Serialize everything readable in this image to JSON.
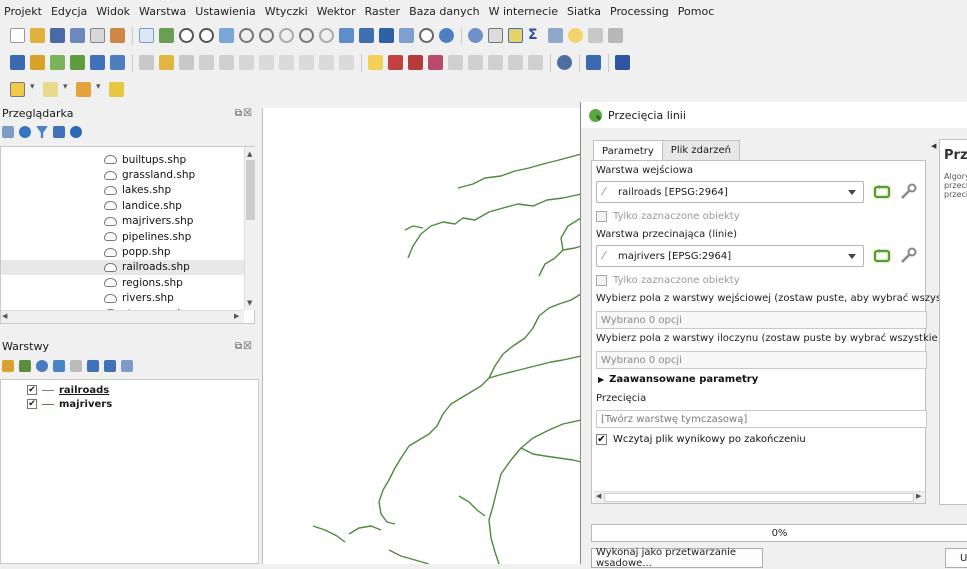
{
  "menubar": [
    "Projekt",
    "Edycja",
    "Widok",
    "Warstwa",
    "Ustawienia",
    "Wtyczki",
    "Wektor",
    "Raster",
    "Baza danych",
    "W internecie",
    "Siatka",
    "Processing",
    "Pomoc"
  ],
  "browser": {
    "title": "Przeglądarka",
    "title_buttons": "⧉☒",
    "files": [
      "builtups.shp",
      "grassland.shp",
      "lakes.shp",
      "landice.shp",
      "majrivers.shp",
      "pipelines.shp",
      "popp.shp",
      "railroads.shp",
      "regions.shp",
      "rivers.shp",
      "storagep.shp"
    ],
    "selected_file": "railroads.shp"
  },
  "layers": {
    "title": "Warstwy",
    "title_buttons": "⧉☒",
    "items": [
      {
        "name": "railroads",
        "checked": "✔"
      },
      {
        "name": "majrivers",
        "checked": "✔"
      }
    ]
  },
  "dialog": {
    "title": "Przecięcia linii",
    "tabs": [
      "Parametry",
      "Plik zdarzeń"
    ],
    "input_layer_label": "Warstwa wejściowa",
    "input_layer_value": "railroads [EPSG:2964]",
    "selected_only_1": "Tylko zaznaczone obiekty",
    "intersect_layer_label": "Warstwa przecinająca (linie)",
    "intersect_layer_value": "majrivers [EPSG:2964]",
    "selected_only_2": "Tylko zaznaczone obiekty",
    "fields_input_label": "Wybierz pola z warstwy wejściowej (zostaw puste, aby wybrać wszystkie) [opcjo",
    "fields_input_value": "Wybrano 0 opcji",
    "fields_intersect_label": "Wybierz pola z warstwy iloczynu (zostaw puste by wybrać wszystkie) [opcjonaln",
    "fields_intersect_value": "Wybrano 0 opcji",
    "advanced_label": "Zaawansowane parametry",
    "output_label": "Przecięcia",
    "output_placeholder": "[Twórz warstwę tymczasową]",
    "load_result_label": "Wczytaj plik wynikowy po zakończeniu",
    "load_result_check": "✔",
    "help_title": "Prz",
    "help_text": "Algory\nprzeci\nprzeci",
    "progress": "0%",
    "batch_button": "Wykonaj jako przetwarzanie wsadowe...",
    "run_button": "Ur"
  }
}
